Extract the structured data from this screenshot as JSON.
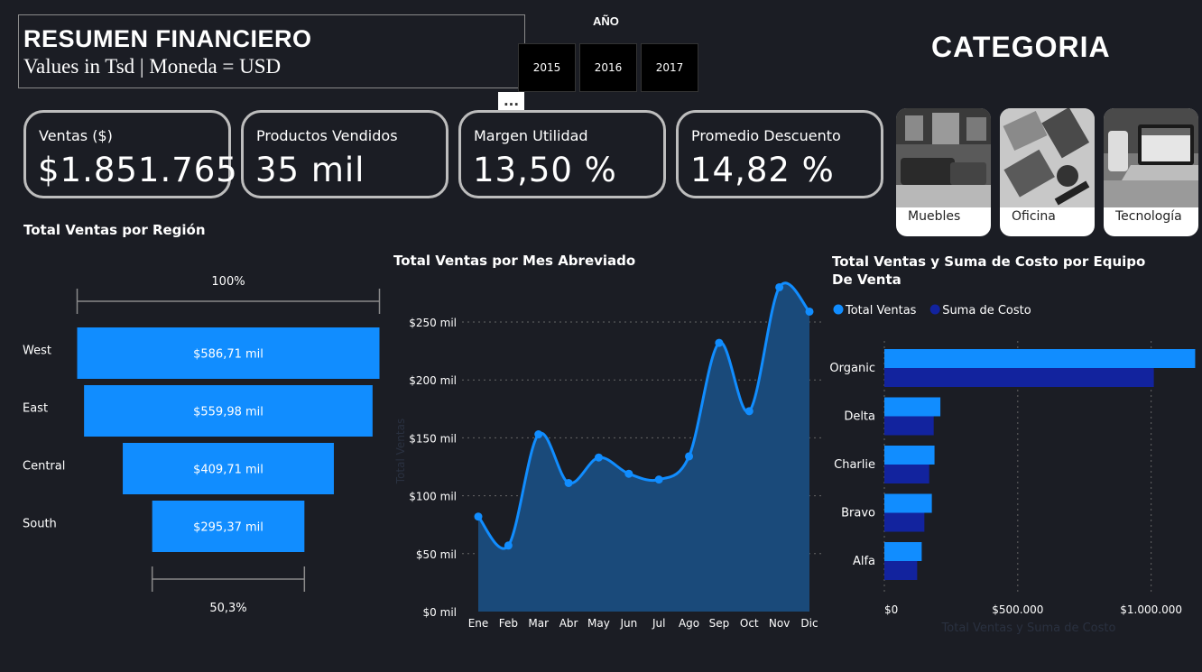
{
  "header": {
    "title": "RESUMEN FINANCIERO",
    "subtitle": "Values in Tsd | Moneda = USD"
  },
  "year_filter": {
    "label": "AÑO",
    "years": [
      "2015",
      "2016",
      "2017"
    ],
    "more": "···"
  },
  "category": {
    "title": "CATEGORIA",
    "cards": [
      {
        "label": "Muebles",
        "icon": "furniture-photo"
      },
      {
        "label": "Oficina",
        "icon": "office-supplies-photo"
      },
      {
        "label": "Tecnología",
        "icon": "laptop-photo"
      }
    ]
  },
  "kpis": [
    {
      "label": "Ventas ($)",
      "value": "$1.851.765"
    },
    {
      "label": "Productos Vendidos",
      "value": "35 mil"
    },
    {
      "label": "Margen Utilidad",
      "value": "13,50 %"
    },
    {
      "label": "Promedio Descuento",
      "value": "14,82 %"
    }
  ],
  "colors": {
    "background": "#1b1d24",
    "accent_blue": "#118dff",
    "dark_blue": "#12239e",
    "area_fill": "#1a4a7a"
  },
  "chart_data": [
    {
      "type": "bar",
      "subtype": "funnel",
      "title": "Total Ventas por Región",
      "categories": [
        "West",
        "East",
        "Central",
        "South"
      ],
      "values": [
        586.71,
        559.98,
        409.71,
        295.37
      ],
      "labels": [
        "$586,71 mil",
        "$559,98 mil",
        "$409,71 mil",
        "$295,37 mil"
      ],
      "top_percent": "100%",
      "bottom_percent": "50,3%"
    },
    {
      "type": "area",
      "title": "Total Ventas por Mes Abreviado",
      "ylabel": "Total Ventas",
      "categories": [
        "Ene",
        "Feb",
        "Mar",
        "Abr",
        "May",
        "Jun",
        "Jul",
        "Ago",
        "Sep",
        "Oct",
        "Nov",
        "Dic"
      ],
      "values": [
        82,
        57,
        153,
        111,
        133,
        119,
        114,
        134,
        232,
        173,
        280,
        259
      ],
      "yticks": [
        "$0 mil",
        "$50 mil",
        "$100 mil",
        "$150 mil",
        "$200 mil",
        "$250 mil"
      ],
      "ylim": [
        0,
        250
      ],
      "grid": true
    },
    {
      "type": "bar",
      "orientation": "horizontal",
      "title": "Total Ventas y Suma de Costo por Equipo De Venta",
      "xlabel": "Total Ventas y Suma de Costo",
      "categories": [
        "Organic",
        "Delta",
        "Charlie",
        "Bravo",
        "Alfa"
      ],
      "series": [
        {
          "name": "Total Ventas",
          "values": [
            1165000,
            210000,
            188000,
            178000,
            140000
          ]
        },
        {
          "name": "Suma de Costo",
          "values": [
            1010000,
            185000,
            168000,
            150000,
            123000
          ]
        }
      ],
      "xticks": [
        "$0",
        "$500.000",
        "$1.000.000"
      ],
      "xlim": [
        0,
        1150000
      ],
      "legend": "top-left"
    }
  ]
}
